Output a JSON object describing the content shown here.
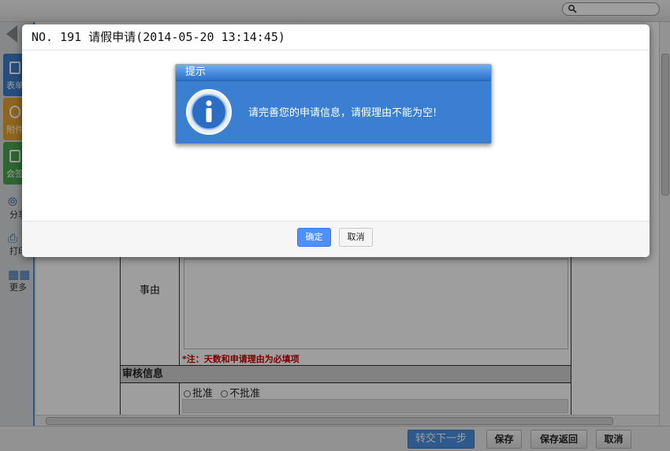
{
  "sidebar": {
    "tools": [
      {
        "label": "表单"
      },
      {
        "label": "附件"
      },
      {
        "label": "会签"
      }
    ],
    "links": [
      {
        "label": "分享"
      },
      {
        "label": "打印"
      },
      {
        "label": "更多"
      }
    ]
  },
  "form": {
    "reason_label": "事由",
    "required_note": "*注：天数和申请理由为必填项",
    "audit_section": "审核信息",
    "approve_option": "批准",
    "reject_option": "不批准"
  },
  "bottom_bar": {
    "forward": "转交下一步",
    "save": "保存",
    "save_return": "保存返回",
    "cancel": "取消"
  },
  "dialog": {
    "title": "NO. 191 请假申请(2014-05-20 13:14:45)",
    "ok": "确定",
    "cancel": "取消"
  },
  "alert": {
    "title": "提示",
    "message": "请完善您的申请信息，请假理由不能为空!"
  },
  "colors": {
    "accent": "#4a90e2",
    "alert_bg": "#3a7fd1",
    "required_note": "#cc0000"
  }
}
